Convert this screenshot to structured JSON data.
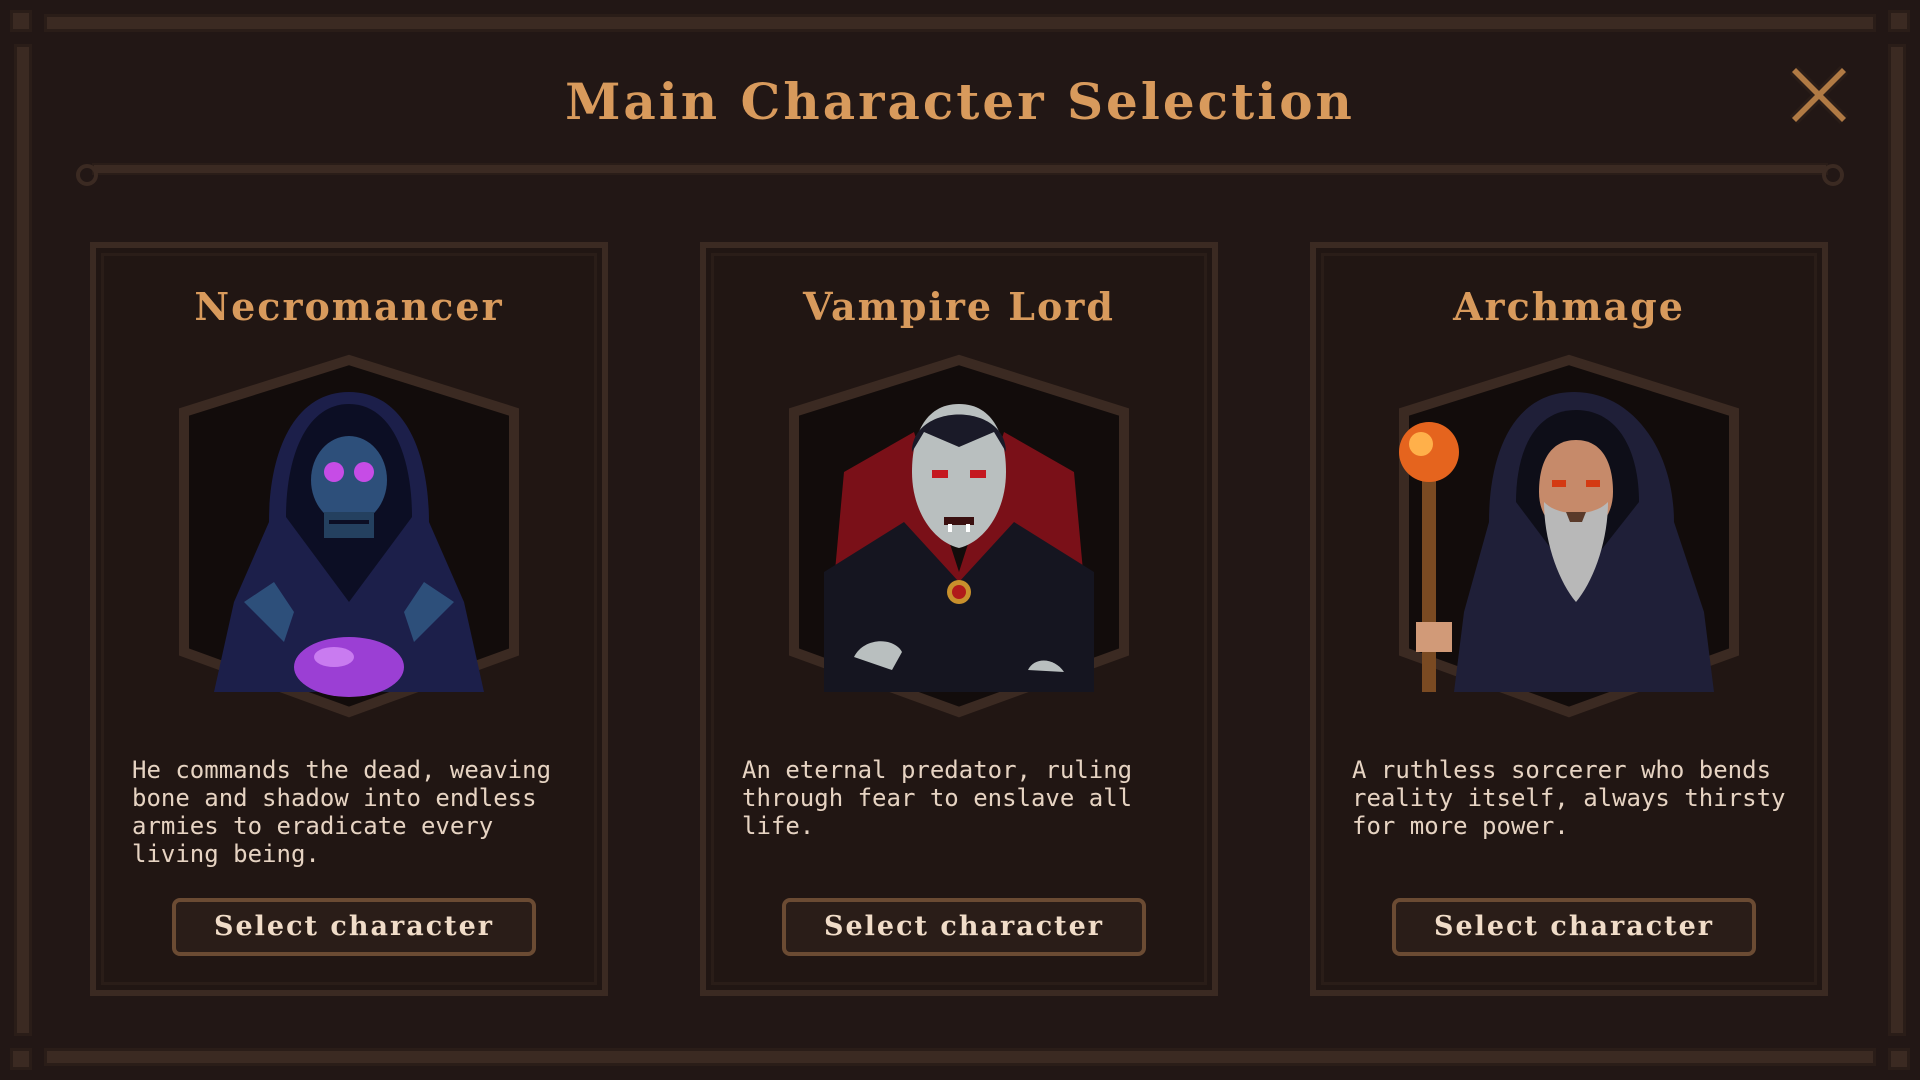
{
  "title": "Main Character Selection",
  "close": {
    "icon": "close-icon"
  },
  "cards": [
    {
      "name": "Necromancer",
      "description": "He commands the dead, weaving bone and shadow into endless armies to eradicate every living being.",
      "button_label": "Select character",
      "portrait_icon": "necromancer-portrait-icon"
    },
    {
      "name": "Vampire Lord",
      "description": "An eternal predator, ruling through fear to enslave all life.",
      "button_label": "Select character",
      "portrait_icon": "vampire-lord-portrait-icon"
    },
    {
      "name": "Archmage",
      "description": "A ruthless sorcerer who bends reality itself, always thirsty for more power.",
      "button_label": "Select character",
      "portrait_icon": "archmage-portrait-icon"
    }
  ],
  "colors": {
    "background": "#221715",
    "frame": "#3b2a22",
    "accent_text": "#d89a5c",
    "body_text": "#e6d3c2",
    "button_border": "#6b4b33"
  }
}
